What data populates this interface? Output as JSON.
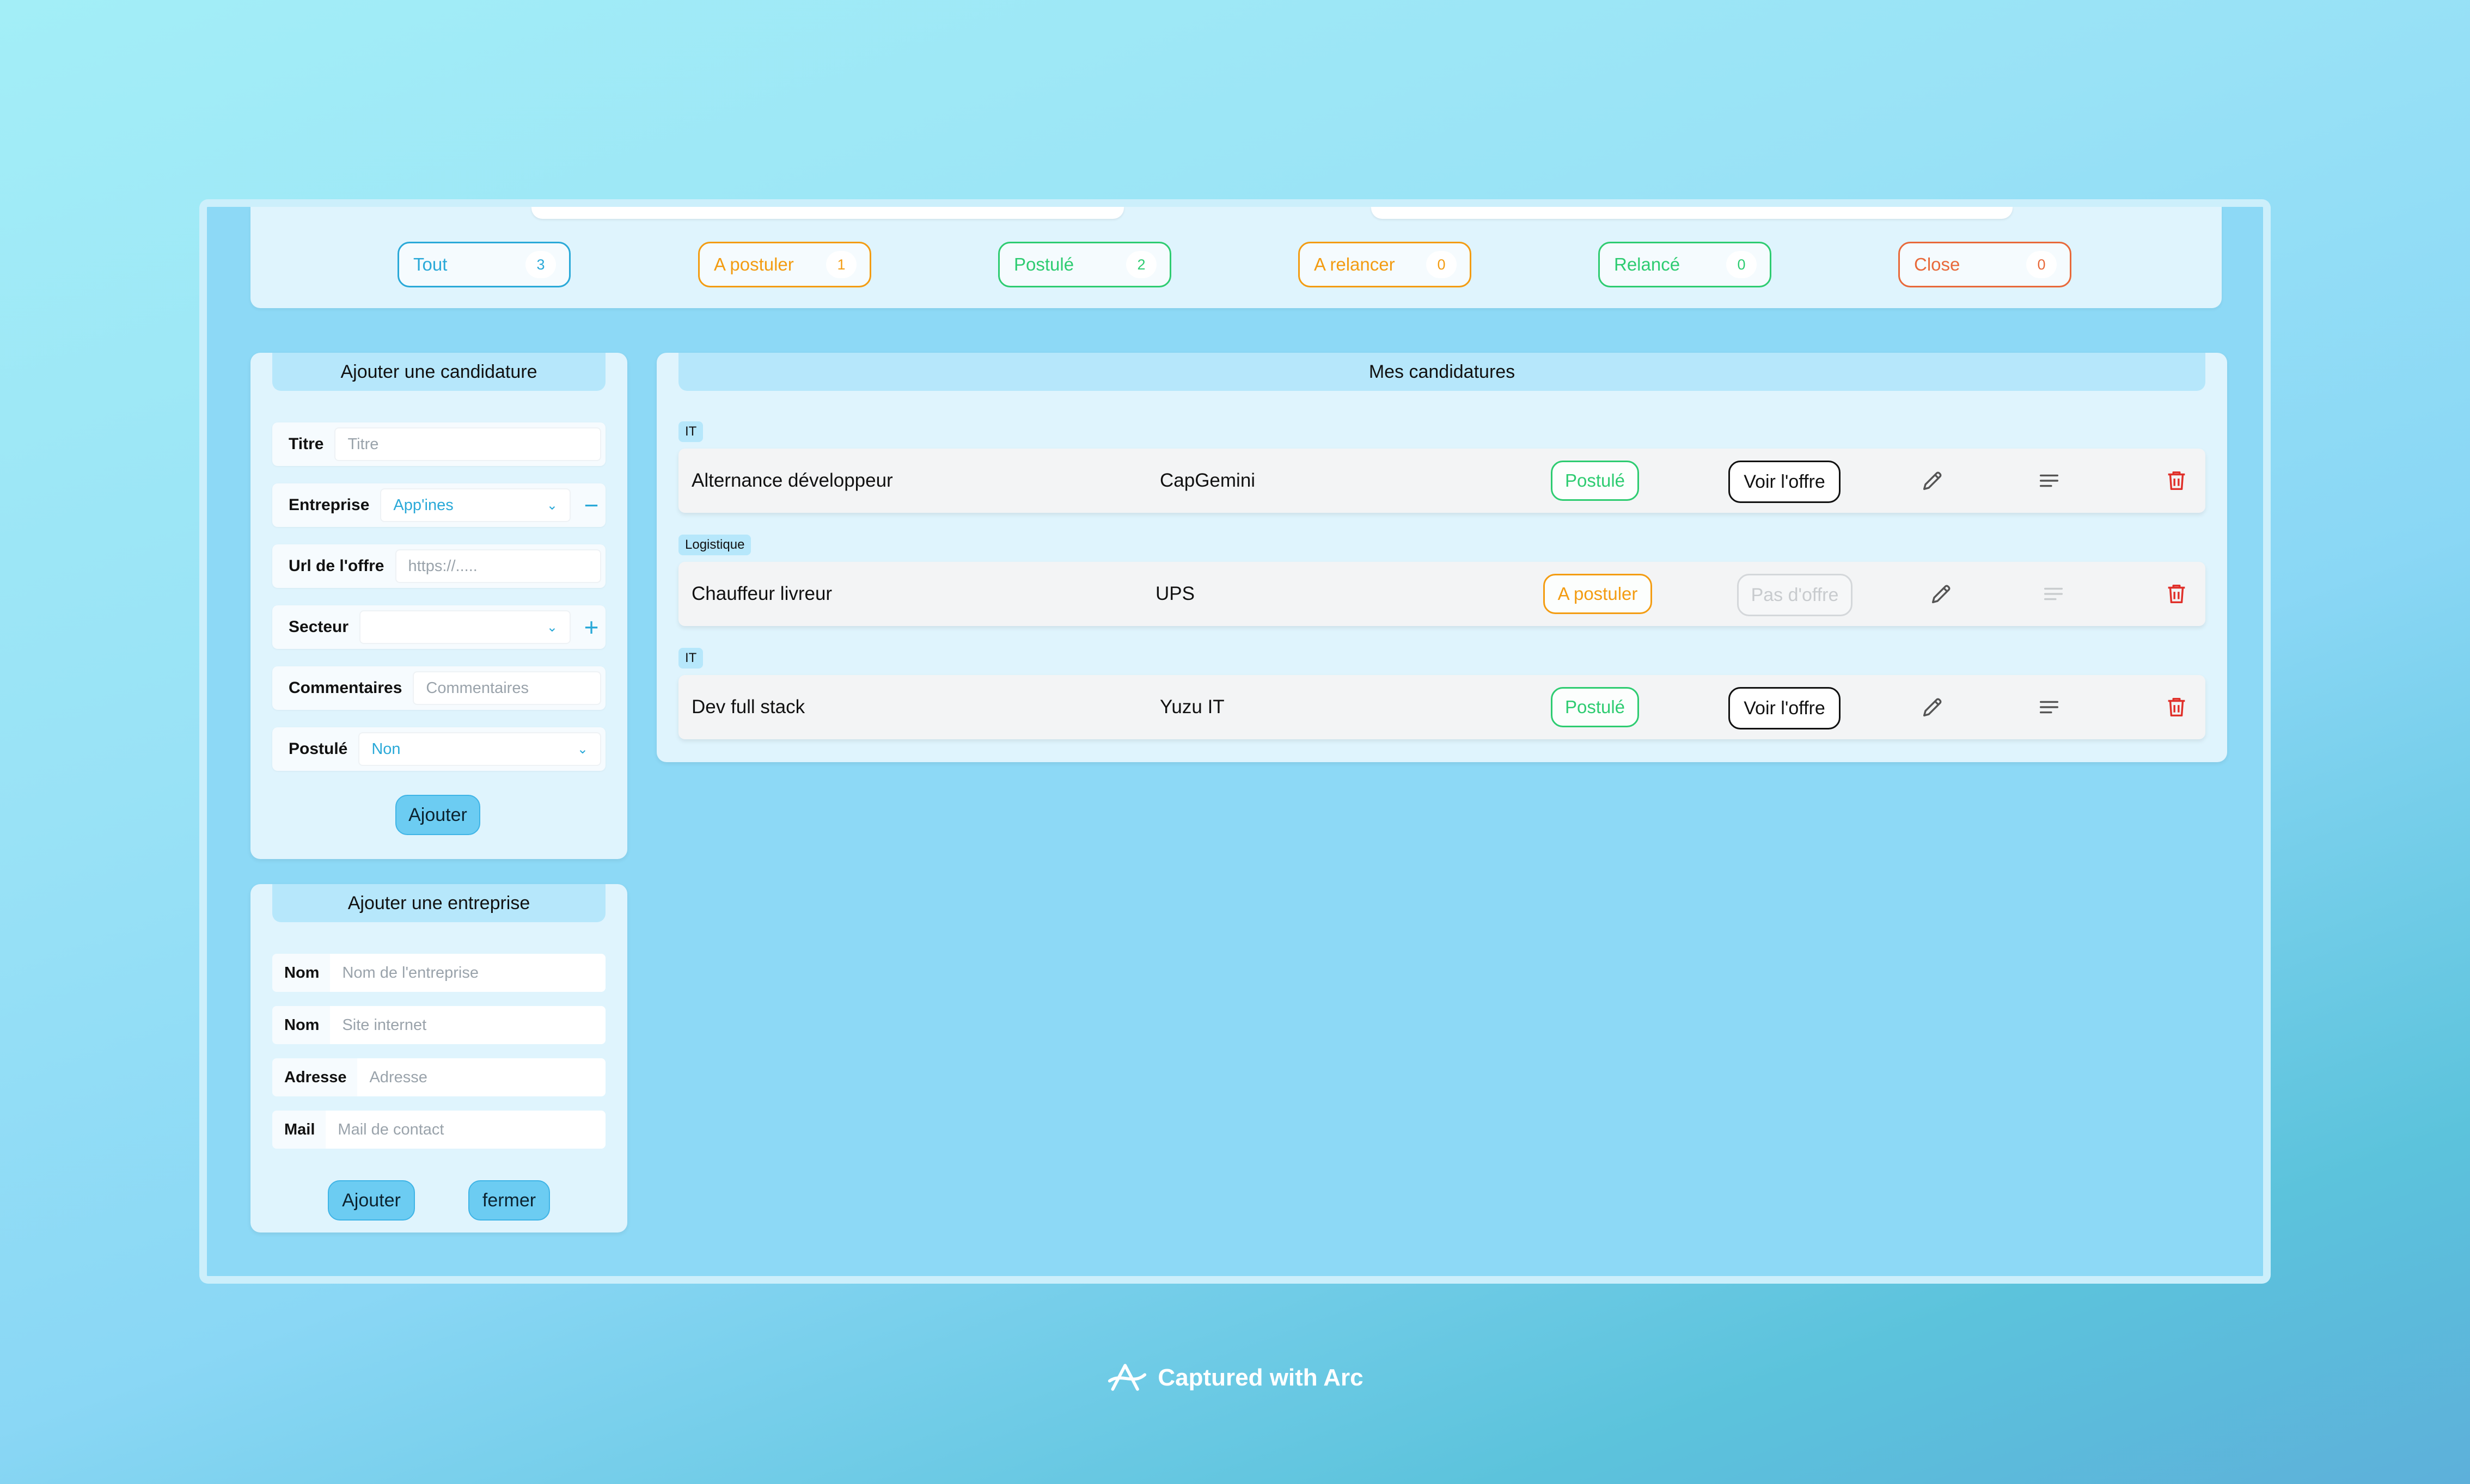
{
  "filters": [
    {
      "label": "Tout",
      "count": "3",
      "color": "#2aa9d8"
    },
    {
      "label": "A postuler",
      "count": "1",
      "color": "#f39c12"
    },
    {
      "label": "Postulé",
      "count": "2",
      "color": "#2ecc71"
    },
    {
      "label": "A relancer",
      "count": "0",
      "color": "#f39c12"
    },
    {
      "label": "Relancé",
      "count": "0",
      "color": "#2ecc71"
    },
    {
      "label": "Close",
      "count": "0",
      "color": "#e8693a"
    }
  ],
  "add_application": {
    "title": "Ajouter une candidature",
    "fields": {
      "titre": {
        "label": "Titre",
        "placeholder": "Titre"
      },
      "entreprise": {
        "label": "Entreprise",
        "value": "App'ines"
      },
      "url": {
        "label": "Url de l'offre",
        "placeholder": "https://....."
      },
      "secteur": {
        "label": "Secteur",
        "value": ""
      },
      "commentaires": {
        "label": "Commentaires",
        "placeholder": "Commentaires"
      },
      "postule": {
        "label": "Postulé",
        "value": "Non"
      }
    },
    "submit": "Ajouter"
  },
  "add_company": {
    "title": "Ajouter une entreprise",
    "fields": [
      {
        "label": "Nom",
        "placeholder": "Nom de l'entreprise"
      },
      {
        "label": "Nom",
        "placeholder": "Site internet"
      },
      {
        "label": "Adresse",
        "placeholder": "Adresse"
      },
      {
        "label": "Mail",
        "placeholder": "Mail de contact"
      }
    ],
    "submit": "Ajouter",
    "close": "fermer"
  },
  "applications": {
    "title": "Mes candidatures",
    "items": [
      {
        "sector": "IT",
        "title": "Alternance développeur",
        "company": "CapGemini",
        "status": "Postulé",
        "status_color": "#2ecc71",
        "offer": "Voir l'offre",
        "has_offer": true,
        "has_comment": true
      },
      {
        "sector": "Logistique",
        "title": "Chauffeur livreur",
        "company": "UPS",
        "status": "A postuler",
        "status_color": "#f39c12",
        "offer": "Pas d'offre",
        "has_offer": false,
        "has_comment": false
      },
      {
        "sector": "IT",
        "title": "Dev full stack",
        "company": "Yuzu IT",
        "status": "Postulé",
        "status_color": "#2ecc71",
        "offer": "Voir l'offre",
        "has_offer": true,
        "has_comment": true
      }
    ]
  },
  "footer": {
    "text": "Captured with Arc",
    "icon": "arc-logo-icon"
  }
}
